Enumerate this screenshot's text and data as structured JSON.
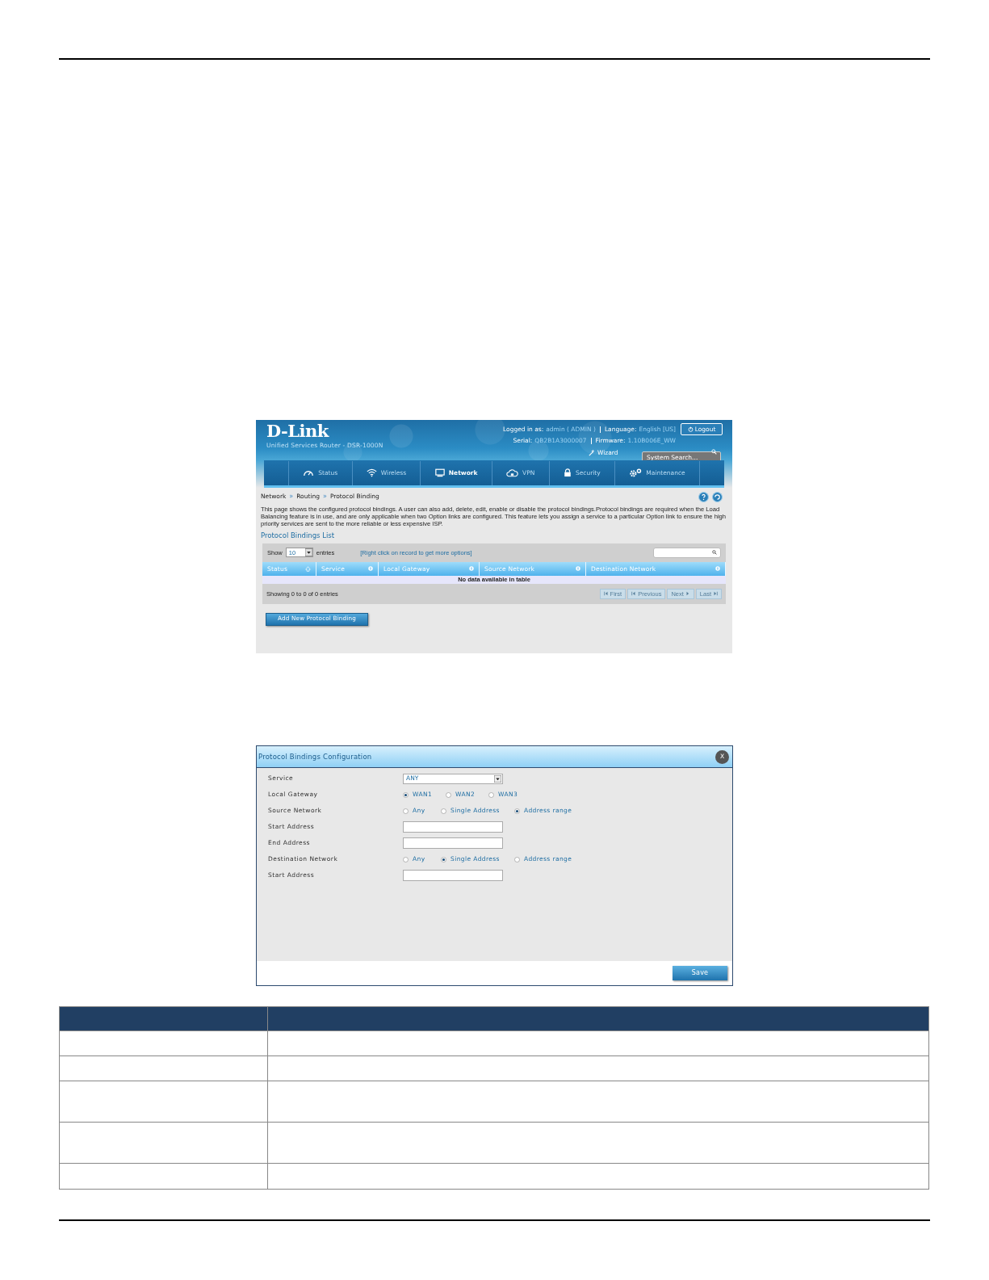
{
  "router_screenshot": {
    "header": {
      "logo": "D-Link",
      "subtitle": "Unified Services Router - DSR-1000N",
      "logged_in_label": "Logged in as:",
      "logged_in_value": "admin ( ADMIN )",
      "language_label": "Language:",
      "language_value": "English [US]",
      "logout": "Logout",
      "serial_label": "Serial:",
      "serial_value": "QB2B1A3000007",
      "firmware_label": "Firmware:",
      "firmware_value": "1.10B006E_WW",
      "wizard": "Wizard",
      "search_placeholder": "System Search..."
    },
    "nav": [
      {
        "label": "Status",
        "kind": "gauge",
        "selected": false
      },
      {
        "label": "Wireless",
        "kind": "wifi",
        "selected": false
      },
      {
        "label": "Network",
        "kind": "monitor",
        "selected": true
      },
      {
        "label": "VPN",
        "kind": "cloud",
        "selected": false
      },
      {
        "label": "Security",
        "kind": "lock",
        "selected": false
      },
      {
        "label": "Maintenance",
        "kind": "gears",
        "selected": false
      }
    ],
    "breadcrumb": [
      {
        "label": "Network"
      },
      {
        "separator": "»",
        "label": "Routing"
      },
      {
        "separator": "»",
        "label": "Protocol Binding"
      }
    ],
    "description": "This page shows the configured protocol bindings. A user can also add, delete, edit, enable or disable the protocol bindings.Protocol bindings are required when the Load Balancing feature is in use, and are only applicable when two Option links are configured. This feature lets you assign a service to a particular Option link to ensure the high priority services are sent to the more reliable or less expensive ISP.",
    "list": {
      "title": "Protocol Bindings List",
      "show_label": "Show",
      "page_size": "10",
      "entries_label": "entries",
      "hint": "[Right click on record to get more options]",
      "columns": [
        {
          "label": "Status",
          "sorted": true
        },
        {
          "label": "Service",
          "sorted": false
        },
        {
          "label": "Local Gateway",
          "sorted": false
        },
        {
          "label": "Source Network",
          "sorted": false
        },
        {
          "label": "Destination Network",
          "sorted": false
        }
      ],
      "empty_message": "No data available in table",
      "info": "Showing 0 to 0 of 0 entries",
      "pager": [
        {
          "label": "First",
          "kind": "first",
          "disabled": true
        },
        {
          "label": "Previous",
          "kind": "prev",
          "disabled": true
        },
        {
          "label": "Next",
          "kind": "next",
          "disabled": true
        },
        {
          "label": "Last",
          "kind": "last",
          "disabled": true
        }
      ],
      "add_button": "Add New Protocol Binding"
    }
  },
  "dialog": {
    "title": "Protocol Bindings Configuration",
    "close": "X",
    "rows": [
      {
        "label": "Service",
        "kind": "select",
        "value": "ANY"
      },
      {
        "label": "Local Gateway",
        "kind": "radio",
        "options": [
          {
            "label": "WAN1",
            "selected": true
          },
          {
            "label": "WAN2",
            "selected": false
          },
          {
            "label": "WAN3",
            "selected": false
          }
        ]
      },
      {
        "label": "Source Network",
        "kind": "radio",
        "options": [
          {
            "label": "Any",
            "selected": false
          },
          {
            "label": "Single Address",
            "selected": false
          },
          {
            "label": "Address range",
            "selected": true
          }
        ]
      },
      {
        "label": "Start Address",
        "kind": "text"
      },
      {
        "label": "End Address",
        "kind": "text"
      },
      {
        "label": "Destination Network",
        "kind": "radio",
        "options": [
          {
            "label": "Any",
            "selected": false
          },
          {
            "label": "Single Address",
            "selected": true
          },
          {
            "label": "Address range",
            "selected": false
          }
        ]
      },
      {
        "label": "Start Address",
        "kind": "text"
      }
    ],
    "save": "Save"
  },
  "doc_table": {
    "rows": [
      {
        "kind": "single"
      },
      {
        "kind": "single"
      },
      {
        "kind": "double"
      },
      {
        "kind": "double"
      },
      {
        "kind": "single"
      }
    ]
  }
}
